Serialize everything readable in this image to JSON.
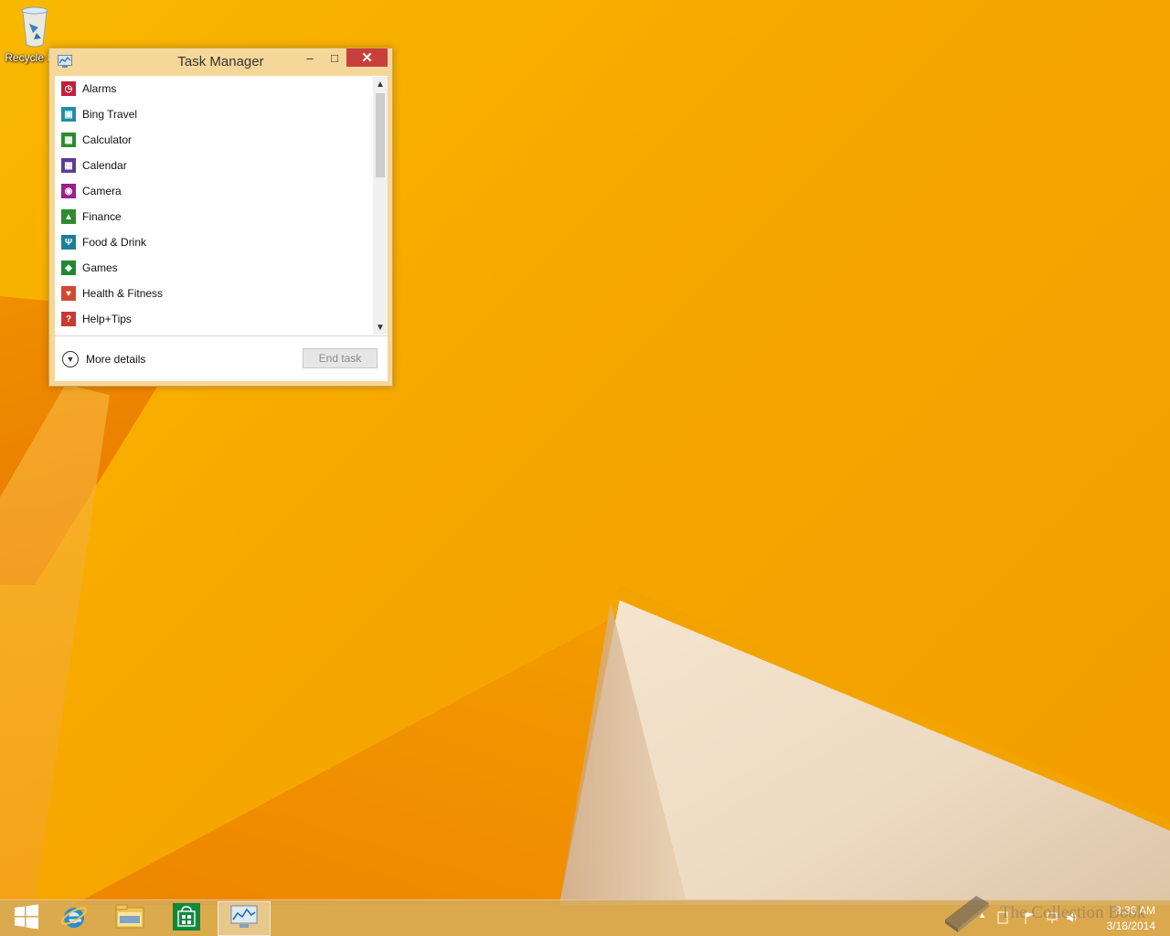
{
  "desktop": {
    "recycle_bin_label": "Recycle Bin"
  },
  "task_manager": {
    "title": "Task Manager",
    "window_buttons": {
      "minimize": "–",
      "maximize": "□",
      "close": "✕"
    },
    "apps": [
      {
        "label": "Alarms",
        "icon": "alarm-clock-icon",
        "color": "#c1203b",
        "glyph": "◷"
      },
      {
        "label": "Bing Travel",
        "icon": "suitcase-icon",
        "color": "#1e8fa8",
        "glyph": "▣"
      },
      {
        "label": "Calculator",
        "icon": "calculator-icon",
        "color": "#2c8b2c",
        "glyph": "▦"
      },
      {
        "label": "Calendar",
        "icon": "calendar-icon",
        "color": "#5a3c96",
        "glyph": "▦"
      },
      {
        "label": "Camera",
        "icon": "camera-icon",
        "color": "#9a1f8e",
        "glyph": "◉"
      },
      {
        "label": "Finance",
        "icon": "finance-chart-icon",
        "color": "#2e8b2e",
        "glyph": "▲"
      },
      {
        "label": "Food & Drink",
        "icon": "utensils-icon",
        "color": "#1a7f9a",
        "glyph": "Ψ"
      },
      {
        "label": "Games",
        "icon": "game-controller-icon",
        "color": "#1f8a2f",
        "glyph": "◆"
      },
      {
        "label": "Health & Fitness",
        "icon": "heart-icon",
        "color": "#d24a2e",
        "glyph": "♥"
      },
      {
        "label": "Help+Tips",
        "icon": "help-icon",
        "color": "#c83a32",
        "glyph": "?"
      }
    ],
    "more_details_label": "More details",
    "end_task_label": "End task"
  },
  "taskbar": {
    "items": [
      {
        "name": "start",
        "icon": "windows-logo-icon"
      },
      {
        "name": "internet-explorer",
        "icon": "internet-explorer-icon"
      },
      {
        "name": "file-explorer",
        "icon": "folder-icon"
      },
      {
        "name": "store",
        "icon": "store-bag-icon"
      },
      {
        "name": "task-manager",
        "icon": "task-manager-icon"
      }
    ],
    "clock": {
      "time": "8:36 AM",
      "date": "3/18/2014"
    },
    "tray_chevron": "▲"
  },
  "watermark": {
    "text": "The Collection Book"
  }
}
